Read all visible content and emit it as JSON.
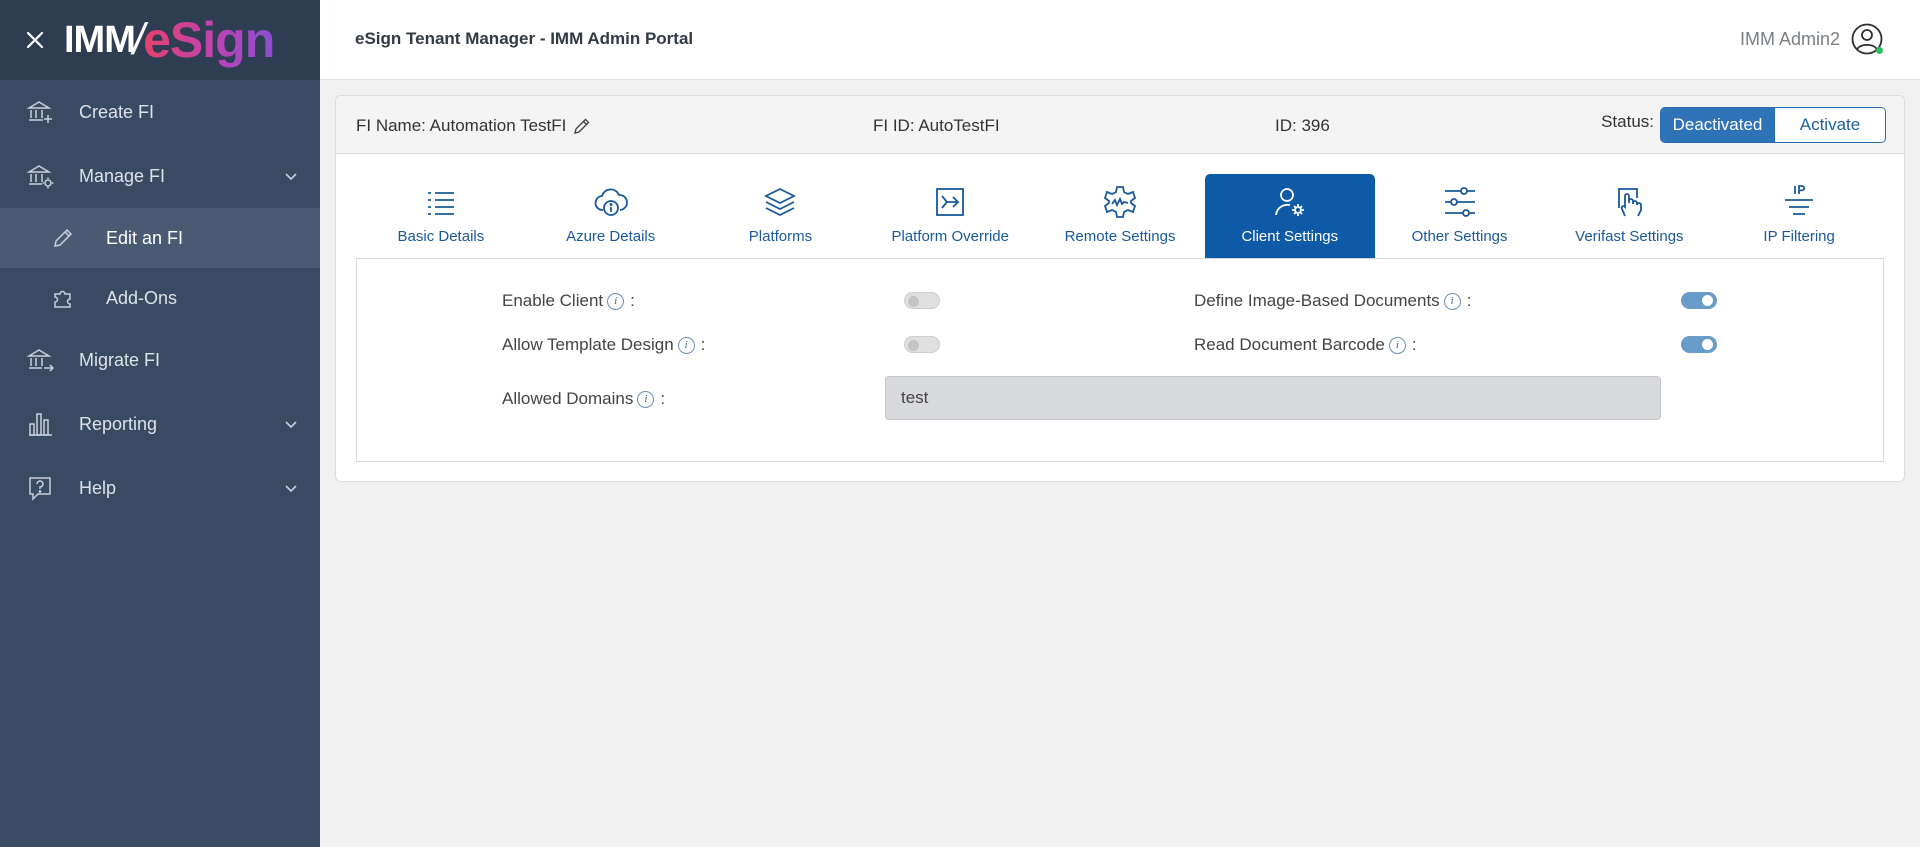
{
  "brand": {
    "imm": "IMM",
    "slash": "/",
    "esign": "eSign"
  },
  "sidebar": {
    "items": [
      {
        "label": "Create FI",
        "icon": "bank-plus-icon"
      },
      {
        "label": "Manage FI",
        "icon": "bank-gear-icon",
        "expandable": true
      },
      {
        "label": "Edit an FI",
        "icon": "pencil-icon",
        "sub": true,
        "active": true
      },
      {
        "label": "Add-Ons",
        "icon": "puzzle-icon",
        "sub": true
      },
      {
        "label": "Migrate FI",
        "icon": "bank-arrow-icon"
      },
      {
        "label": "Reporting",
        "icon": "bar-chart-icon",
        "expandable": true
      },
      {
        "label": "Help",
        "icon": "help-bubble-icon",
        "expandable": true
      }
    ]
  },
  "header": {
    "title": "eSign Tenant Manager - IMM Admin Portal",
    "user": "IMM Admin2"
  },
  "fi": {
    "name_label": "FI Name: Automation TestFI",
    "id_label": "FI ID: AutoTestFI",
    "numeric_id_label": "ID: 396",
    "status_label": "Status:",
    "deactivated": "Deactivated",
    "activate": "Activate"
  },
  "tabs": [
    {
      "label": "Basic Details",
      "icon": "list-icon"
    },
    {
      "label": "Azure Details",
      "icon": "cloud-info-icon"
    },
    {
      "label": "Platforms",
      "icon": "layers-icon"
    },
    {
      "label": "Platform Override",
      "icon": "arrow-into-box-icon"
    },
    {
      "label": "Remote Settings",
      "icon": "gear-signature-icon"
    },
    {
      "label": "Client Settings",
      "icon": "user-gear-icon",
      "active": true
    },
    {
      "label": "Other Settings",
      "icon": "sliders-icon"
    },
    {
      "label": "Verifast Settings",
      "icon": "hand-touch-icon"
    },
    {
      "label": "IP Filtering",
      "icon": "ip-filter-icon"
    }
  ],
  "client_settings": {
    "enable_client": {
      "label": "Enable Client",
      "enabled": false
    },
    "allow_template_design": {
      "label": "Allow Template Design",
      "enabled": false
    },
    "define_image_docs": {
      "label": "Define Image-Based Documents",
      "enabled": true
    },
    "read_barcode": {
      "label": "Read Document Barcode",
      "enabled": true
    },
    "allowed_domains": {
      "label": "Allowed Domains",
      "value": "test"
    },
    "colon": ":",
    "info_glyph": "i"
  },
  "colors": {
    "sidebar": "#3a4a63",
    "accent": "#0f5aa6",
    "toggle_on": "#6a9cc9"
  }
}
